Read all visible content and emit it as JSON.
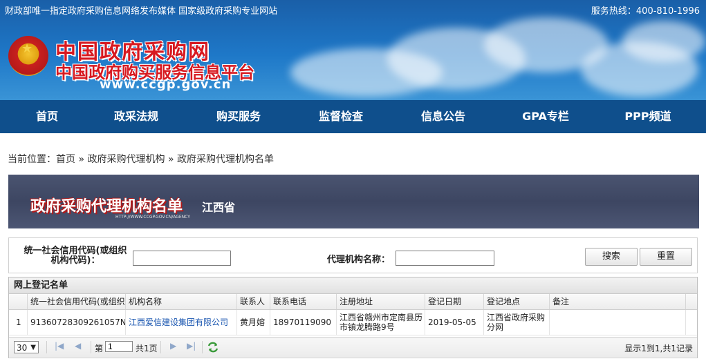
{
  "topbar": {
    "left_text": "财政部唯一指定政府采购信息网络发布媒体  国家级政府采购专业网站",
    "right_text": "服务热线：400-810-1996"
  },
  "header": {
    "brand_title": "中国政府采购网",
    "brand_subtitle": "中国政府购买服务信息平台",
    "brand_url": "www.ccgp.gov.cn",
    "emblem_icon": "national-emblem-icon"
  },
  "nav": {
    "items": [
      {
        "label": "首页"
      },
      {
        "label": "政采法规"
      },
      {
        "label": "购买服务"
      },
      {
        "label": "监督检查"
      },
      {
        "label": "信息公告"
      },
      {
        "label": "GPA专栏"
      },
      {
        "label": "PPP频道"
      }
    ]
  },
  "breadcrumb": {
    "prefix": "当前位置：",
    "home": "首页",
    "sep": "»",
    "level1": "政府采购代理机构",
    "level2": "政府采购代理机构名单"
  },
  "banner": {
    "title": "政府采购代理机构名单",
    "province": "江西省",
    "url": "HTTP://WWW.CCGP.GOV.CN/AGENCY"
  },
  "search": {
    "code_label": "统一社会信用代码(或组织机构代码)：",
    "code_value": "",
    "name_label": "代理机构名称：",
    "name_value": "",
    "search_button": "搜索",
    "reset_button": "重置"
  },
  "grid": {
    "title": "网上登记名单",
    "columns": [
      "统一社会信用代码(或组织机",
      "机构名称",
      "联系人",
      "联系电话",
      "注册地址",
      "登记日期",
      "登记地点",
      "备注"
    ],
    "rows": [
      {
        "index": "1",
        "code": "91360728309261057N",
        "name": "江西爱信建设集团有限公司",
        "contact": "黄月嫆",
        "phone": "18970119090",
        "address": "江西省赣州市定南县历市镇龙腾路9号",
        "date": "2019-05-05",
        "place": "江西省政府采购分网",
        "remark": ""
      }
    ],
    "pager": {
      "page_size": "30",
      "page_label": "第",
      "page_value": "1",
      "total_pages": "共1页",
      "summary": "显示1到1,共1记录"
    }
  }
}
